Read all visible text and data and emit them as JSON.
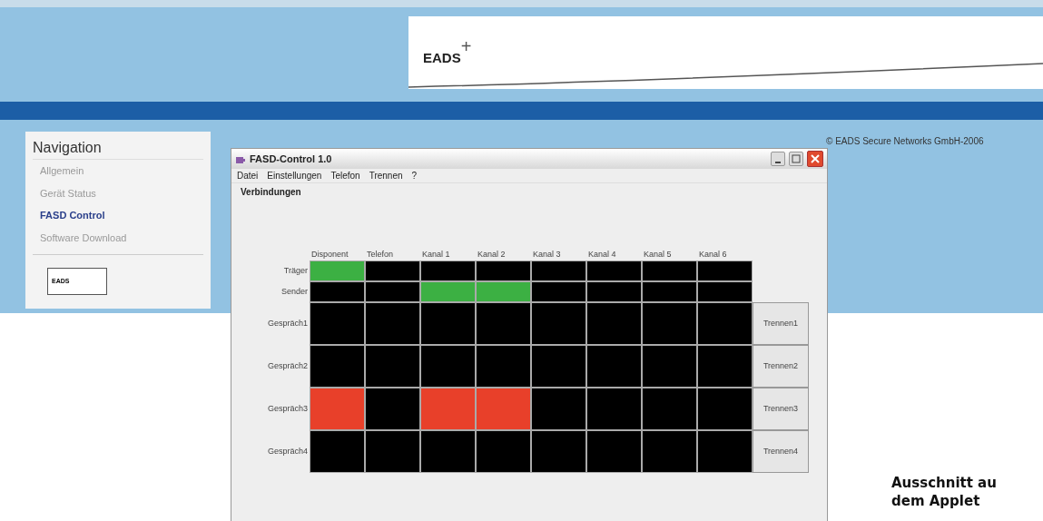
{
  "header": {
    "logo": "EADS",
    "logo_mark": "+"
  },
  "copyright": "© EADS Secure Networks GmbH-2006",
  "navigation": {
    "title": "Navigation",
    "items": [
      {
        "label": "Allgemein",
        "selected": false
      },
      {
        "label": "Gerät Status",
        "selected": false
      },
      {
        "label": "FASD Control",
        "selected": true
      },
      {
        "label": "Software Download",
        "selected": false
      }
    ],
    "badge": "EADS"
  },
  "applet": {
    "title": "FASD-Control 1.0",
    "menu": [
      "Datei",
      "Einstellungen",
      "Telefon",
      "Trennen",
      "?"
    ],
    "section": "Verbindungen",
    "columns": [
      "Disponent",
      "Telefon",
      "Kanal 1",
      "Kanal 2",
      "Kanal 3",
      "Kanal 4",
      "Kanal 5",
      "Kanal 6"
    ],
    "rows": [
      {
        "label": "Träger",
        "kind": "signal",
        "cells": [
          {
            "color": "#3cb043"
          },
          {
            "color": "#000000"
          },
          {
            "color": "#000000"
          },
          {
            "color": "#000000"
          },
          {
            "color": "#000000"
          },
          {
            "color": "#000000"
          },
          {
            "color": "#000000"
          },
          {
            "color": "#000000"
          }
        ]
      },
      {
        "label": "Sender",
        "kind": "signal",
        "cells": [
          {
            "color": "#000000"
          },
          {
            "color": "#000000"
          },
          {
            "color": "#3cb043"
          },
          {
            "color": "#3cb043"
          },
          {
            "color": "#000000"
          },
          {
            "color": "#000000"
          },
          {
            "color": "#000000"
          },
          {
            "color": "#000000"
          }
        ]
      },
      {
        "label": "Gespräch1",
        "kind": "call",
        "button": "Trennen1",
        "cells": [
          {
            "color": "#000000"
          },
          {
            "color": "#000000"
          },
          {
            "color": "#000000"
          },
          {
            "color": "#000000"
          },
          {
            "color": "#000000"
          },
          {
            "color": "#000000"
          },
          {
            "color": "#000000"
          },
          {
            "color": "#000000"
          }
        ]
      },
      {
        "label": "Gespräch2",
        "kind": "call",
        "button": "Trennen2",
        "cells": [
          {
            "color": "#000000"
          },
          {
            "color": "#000000"
          },
          {
            "color": "#000000"
          },
          {
            "color": "#000000"
          },
          {
            "color": "#000000"
          },
          {
            "color": "#000000"
          },
          {
            "color": "#000000"
          },
          {
            "color": "#000000"
          }
        ]
      },
      {
        "label": "Gespräch3",
        "kind": "call",
        "button": "Trennen3",
        "cells": [
          {
            "color": "#e8402a"
          },
          {
            "color": "#000000"
          },
          {
            "color": "#e8402a"
          },
          {
            "color": "#e8402a"
          },
          {
            "color": "#000000"
          },
          {
            "color": "#000000"
          },
          {
            "color": "#000000"
          },
          {
            "color": "#000000"
          }
        ]
      },
      {
        "label": "Gespräch4",
        "kind": "call",
        "button": "Trennen4",
        "cells": [
          {
            "color": "#000000"
          },
          {
            "color": "#000000"
          },
          {
            "color": "#000000"
          },
          {
            "color": "#000000"
          },
          {
            "color": "#000000"
          },
          {
            "color": "#000000"
          },
          {
            "color": "#000000"
          },
          {
            "color": "#000000"
          }
        ]
      }
    ]
  },
  "caption": [
    "Ausschnitt au",
    "dem Applet"
  ]
}
